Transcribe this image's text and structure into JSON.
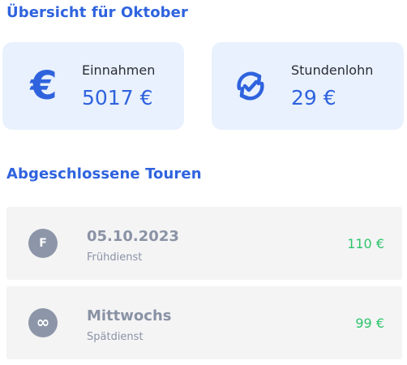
{
  "overview": {
    "title": "Übersicht für Oktober",
    "income": {
      "icon": "euro-icon",
      "label": "Einnahmen",
      "value": "5017 €"
    },
    "hourly_wage": {
      "icon": "sync-check-icon",
      "label": "Stundenlohn",
      "value": "29 €"
    }
  },
  "tours": {
    "title": "Abgeschlossene Touren",
    "items": [
      {
        "avatar": "F",
        "title": "05.10.2023",
        "subtitle": "Frühdienst",
        "amount": "110 €"
      },
      {
        "avatar": "∞",
        "title": "Mittwochs",
        "subtitle": "Spätdienst",
        "amount": "99 €"
      }
    ]
  },
  "colors": {
    "accent": "#2f63de",
    "card_background": "#e9f1fe",
    "row_background": "#f4f4f5",
    "avatar": "#8d96a8",
    "muted_text": "#8a93a5",
    "amount": "#2ec46a"
  }
}
